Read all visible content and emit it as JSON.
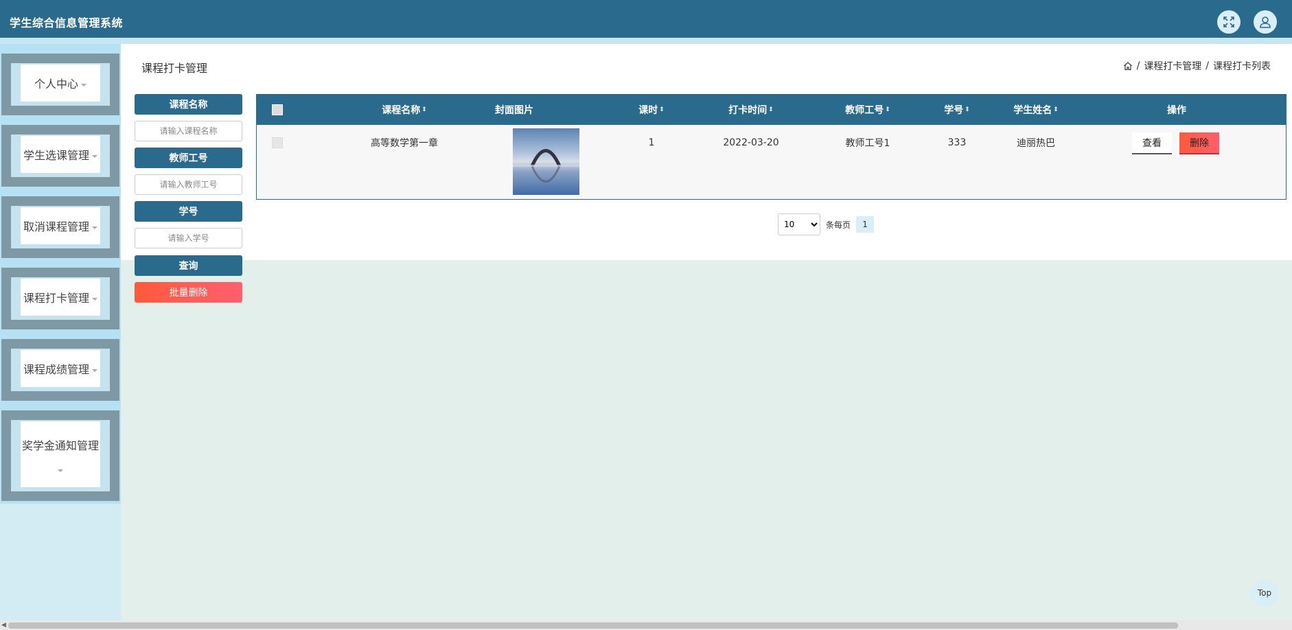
{
  "app": {
    "title": "学生综合信息管理系统"
  },
  "header": {
    "fullscreen_icon": "fullscreen-icon",
    "user_icon": "user-icon"
  },
  "sidebar": {
    "items": [
      {
        "label": "个人中心"
      },
      {
        "label": "学生选课管理"
      },
      {
        "label": "取消课程管理"
      },
      {
        "label": "课程打卡管理"
      },
      {
        "label": "课程成绩管理"
      },
      {
        "label": "奖学金通知管理"
      }
    ]
  },
  "page": {
    "title": "课程打卡管理",
    "breadcrumb": {
      "home_icon": "home-icon",
      "sep": "/",
      "level1": "课程打卡管理",
      "level2": "课程打卡列表"
    }
  },
  "search": {
    "course_label": "课程名称",
    "course_placeholder": "请输入课程名称",
    "teacher_label": "教师工号",
    "teacher_placeholder": "请输入教师工号",
    "student_label": "学号",
    "student_placeholder": "请输入学号",
    "query_button": "查询",
    "batch_delete_button": "批量删除"
  },
  "table": {
    "columns": [
      "课程名称",
      "封面图片",
      "课时",
      "打卡时间",
      "教师工号",
      "学号",
      "学生姓名",
      "操作"
    ],
    "sort_glyph": "⇕",
    "rows": [
      {
        "course": "高等数学第一章",
        "hours": "1",
        "time": "2022-03-20",
        "teacher_id": "教师工号1",
        "student_no": "333",
        "student_name": "迪丽热巴",
        "view": "查看",
        "delete": "删除"
      }
    ]
  },
  "pager": {
    "page_size": "10",
    "per_page_text": "条每页",
    "current_page": "1"
  },
  "footer": {
    "top_button": "Top"
  },
  "colors": {
    "primary": "#2a6a8c",
    "danger": "#ff5a3c",
    "sidebar_bevel": "#7e98a4",
    "sidebar_light": "#c5e3ee"
  }
}
